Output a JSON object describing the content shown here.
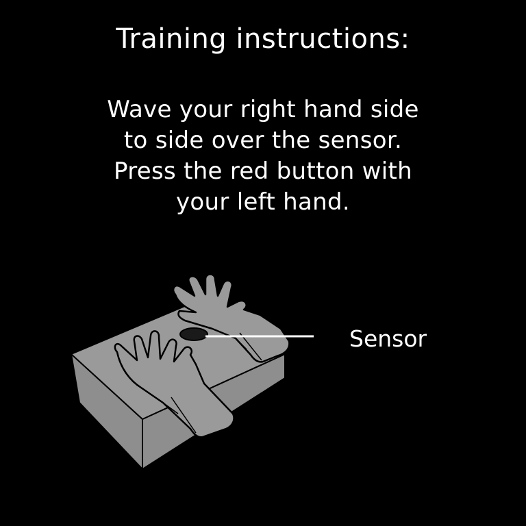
{
  "screen": {
    "title": "Training instructions:",
    "instruction_lines": [
      "Wave your right hand side",
      "to side over the sensor.",
      "Press the red button with",
      "your left hand."
    ],
    "sensor_label": "Sensor"
  },
  "colors": {
    "background": "#000000",
    "text": "#ffffff",
    "box_top": "#9a9a9a",
    "box_side": "#8e8e8e",
    "hand_fill": "#9a9a9a",
    "outline": "#000000"
  },
  "icons": {
    "device": "sensor-box-icon",
    "left_hand": "left-hand-icon",
    "right_hand": "right-hand-icon",
    "sensor": "sensor-icon"
  }
}
